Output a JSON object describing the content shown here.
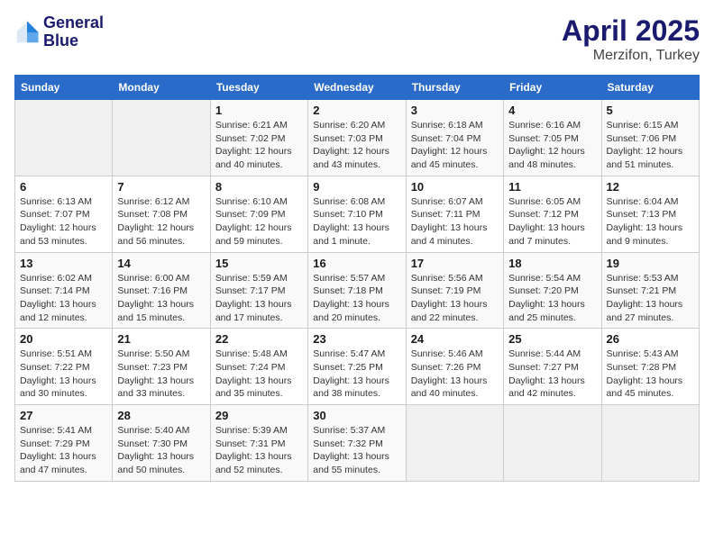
{
  "header": {
    "logo_line1": "General",
    "logo_line2": "Blue",
    "month_year": "April 2025",
    "location": "Merzifon, Turkey"
  },
  "days_of_week": [
    "Sunday",
    "Monday",
    "Tuesday",
    "Wednesday",
    "Thursday",
    "Friday",
    "Saturday"
  ],
  "weeks": [
    [
      {
        "day": "",
        "info": ""
      },
      {
        "day": "",
        "info": ""
      },
      {
        "day": "1",
        "info": "Sunrise: 6:21 AM\nSunset: 7:02 PM\nDaylight: 12 hours and 40 minutes."
      },
      {
        "day": "2",
        "info": "Sunrise: 6:20 AM\nSunset: 7:03 PM\nDaylight: 12 hours and 43 minutes."
      },
      {
        "day": "3",
        "info": "Sunrise: 6:18 AM\nSunset: 7:04 PM\nDaylight: 12 hours and 45 minutes."
      },
      {
        "day": "4",
        "info": "Sunrise: 6:16 AM\nSunset: 7:05 PM\nDaylight: 12 hours and 48 minutes."
      },
      {
        "day": "5",
        "info": "Sunrise: 6:15 AM\nSunset: 7:06 PM\nDaylight: 12 hours and 51 minutes."
      }
    ],
    [
      {
        "day": "6",
        "info": "Sunrise: 6:13 AM\nSunset: 7:07 PM\nDaylight: 12 hours and 53 minutes."
      },
      {
        "day": "7",
        "info": "Sunrise: 6:12 AM\nSunset: 7:08 PM\nDaylight: 12 hours and 56 minutes."
      },
      {
        "day": "8",
        "info": "Sunrise: 6:10 AM\nSunset: 7:09 PM\nDaylight: 12 hours and 59 minutes."
      },
      {
        "day": "9",
        "info": "Sunrise: 6:08 AM\nSunset: 7:10 PM\nDaylight: 13 hours and 1 minute."
      },
      {
        "day": "10",
        "info": "Sunrise: 6:07 AM\nSunset: 7:11 PM\nDaylight: 13 hours and 4 minutes."
      },
      {
        "day": "11",
        "info": "Sunrise: 6:05 AM\nSunset: 7:12 PM\nDaylight: 13 hours and 7 minutes."
      },
      {
        "day": "12",
        "info": "Sunrise: 6:04 AM\nSunset: 7:13 PM\nDaylight: 13 hours and 9 minutes."
      }
    ],
    [
      {
        "day": "13",
        "info": "Sunrise: 6:02 AM\nSunset: 7:14 PM\nDaylight: 13 hours and 12 minutes."
      },
      {
        "day": "14",
        "info": "Sunrise: 6:00 AM\nSunset: 7:16 PM\nDaylight: 13 hours and 15 minutes."
      },
      {
        "day": "15",
        "info": "Sunrise: 5:59 AM\nSunset: 7:17 PM\nDaylight: 13 hours and 17 minutes."
      },
      {
        "day": "16",
        "info": "Sunrise: 5:57 AM\nSunset: 7:18 PM\nDaylight: 13 hours and 20 minutes."
      },
      {
        "day": "17",
        "info": "Sunrise: 5:56 AM\nSunset: 7:19 PM\nDaylight: 13 hours and 22 minutes."
      },
      {
        "day": "18",
        "info": "Sunrise: 5:54 AM\nSunset: 7:20 PM\nDaylight: 13 hours and 25 minutes."
      },
      {
        "day": "19",
        "info": "Sunrise: 5:53 AM\nSunset: 7:21 PM\nDaylight: 13 hours and 27 minutes."
      }
    ],
    [
      {
        "day": "20",
        "info": "Sunrise: 5:51 AM\nSunset: 7:22 PM\nDaylight: 13 hours and 30 minutes."
      },
      {
        "day": "21",
        "info": "Sunrise: 5:50 AM\nSunset: 7:23 PM\nDaylight: 13 hours and 33 minutes."
      },
      {
        "day": "22",
        "info": "Sunrise: 5:48 AM\nSunset: 7:24 PM\nDaylight: 13 hours and 35 minutes."
      },
      {
        "day": "23",
        "info": "Sunrise: 5:47 AM\nSunset: 7:25 PM\nDaylight: 13 hours and 38 minutes."
      },
      {
        "day": "24",
        "info": "Sunrise: 5:46 AM\nSunset: 7:26 PM\nDaylight: 13 hours and 40 minutes."
      },
      {
        "day": "25",
        "info": "Sunrise: 5:44 AM\nSunset: 7:27 PM\nDaylight: 13 hours and 42 minutes."
      },
      {
        "day": "26",
        "info": "Sunrise: 5:43 AM\nSunset: 7:28 PM\nDaylight: 13 hours and 45 minutes."
      }
    ],
    [
      {
        "day": "27",
        "info": "Sunrise: 5:41 AM\nSunset: 7:29 PM\nDaylight: 13 hours and 47 minutes."
      },
      {
        "day": "28",
        "info": "Sunrise: 5:40 AM\nSunset: 7:30 PM\nDaylight: 13 hours and 50 minutes."
      },
      {
        "day": "29",
        "info": "Sunrise: 5:39 AM\nSunset: 7:31 PM\nDaylight: 13 hours and 52 minutes."
      },
      {
        "day": "30",
        "info": "Sunrise: 5:37 AM\nSunset: 7:32 PM\nDaylight: 13 hours and 55 minutes."
      },
      {
        "day": "",
        "info": ""
      },
      {
        "day": "",
        "info": ""
      },
      {
        "day": "",
        "info": ""
      }
    ]
  ]
}
